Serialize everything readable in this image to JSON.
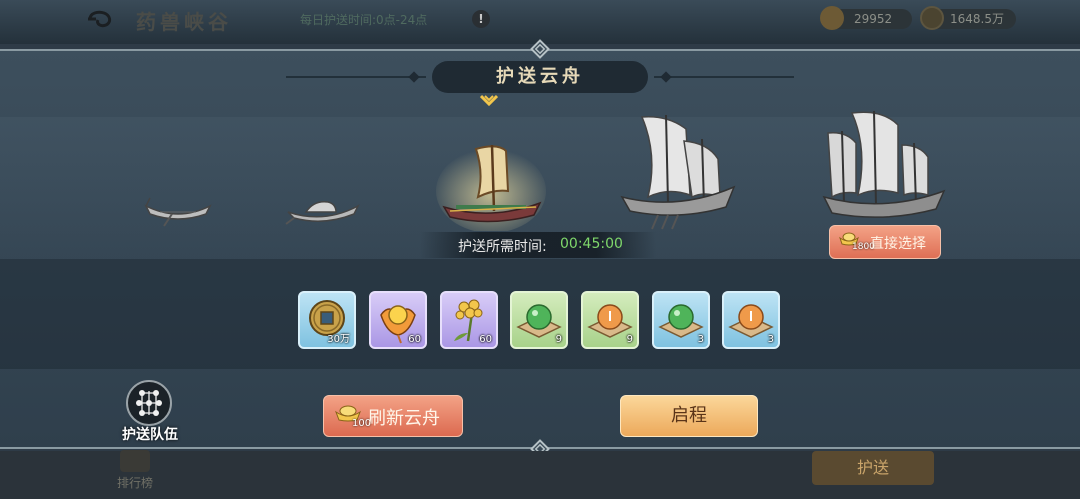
{
  "topbar": {
    "title": "药兽峡谷",
    "daily_escort_time": "每日护送时间:0点-24点",
    "alert_icon": "!",
    "resources": [
      {
        "name": "gold-ingot-icon",
        "value": "29952"
      },
      {
        "name": "copper-coin-icon",
        "value": "1648.5万"
      }
    ]
  },
  "dialog": {
    "title": "护送云舟",
    "time_label": "护送所需时间:",
    "time_value": "00:45:00",
    "direct_select": {
      "label": "直接选择",
      "cost": "1800"
    },
    "selected_ship_index": 2,
    "ships": [
      {
        "name": "ship-small-rowboat"
      },
      {
        "name": "ship-covered-boat"
      },
      {
        "name": "ship-sailboat"
      },
      {
        "name": "ship-large-junk"
      },
      {
        "name": "ship-treasure-junk"
      }
    ],
    "rewards": [
      {
        "icon": "copper-coin-icon",
        "count": "30万",
        "rarity": "blue"
      },
      {
        "icon": "golden-flower-icon",
        "count": "60",
        "rarity": "purple"
      },
      {
        "icon": "golden-herb-icon",
        "count": "60",
        "rarity": "purple"
      },
      {
        "icon": "green-orb-icon",
        "count": "9",
        "rarity": "green"
      },
      {
        "icon": "orange-orb-icon",
        "count": "9",
        "rarity": "green"
      },
      {
        "icon": "green-orb-icon",
        "count": "3",
        "rarity": "blue"
      },
      {
        "icon": "orange-orb-icon",
        "count": "3",
        "rarity": "blue"
      }
    ],
    "team_label": "护送队伍",
    "refresh": {
      "label": "刷新云舟",
      "cost": "100"
    },
    "depart_label": "启程"
  },
  "bottombar": {
    "ranking_label": "排行榜",
    "escort_label": "护送"
  },
  "colors": {
    "accent_gold": "#eca95b",
    "accent_red": "#dc6a50",
    "time_green": "#7fd86b"
  }
}
